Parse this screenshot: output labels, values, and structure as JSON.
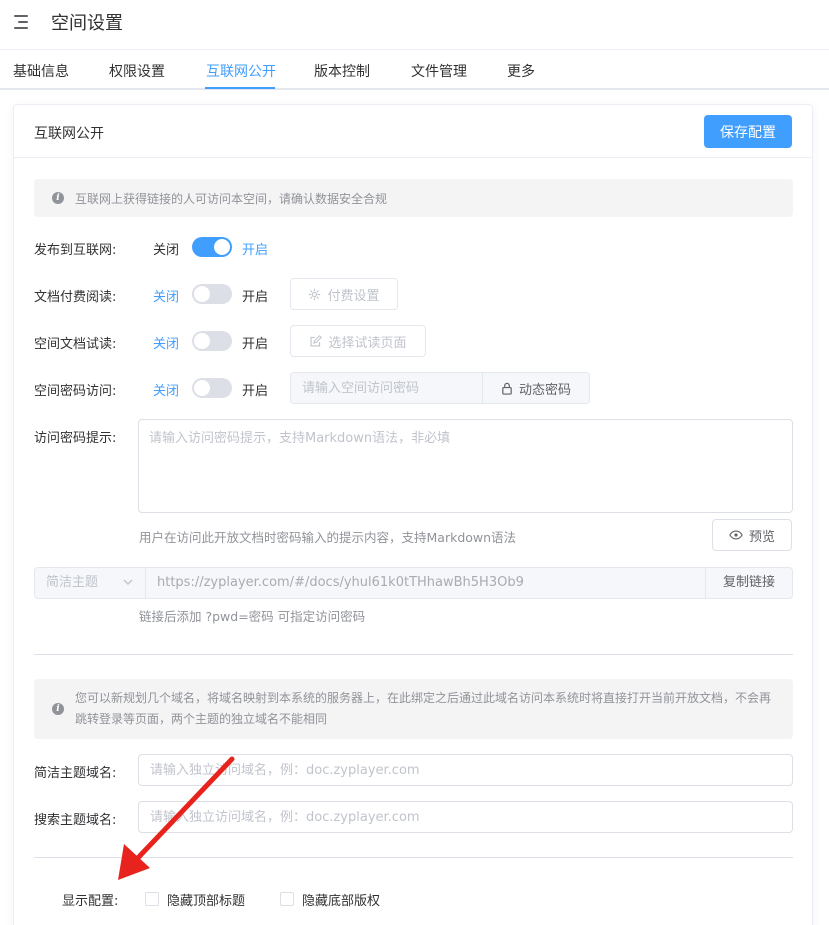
{
  "header": {
    "title": "空间设置"
  },
  "tabs": [
    {
      "label": "基础信息"
    },
    {
      "label": "权限设置"
    },
    {
      "label": "互联网公开",
      "active": true
    },
    {
      "label": "版本控制"
    },
    {
      "label": "文件管理"
    },
    {
      "label": "更多"
    }
  ],
  "card": {
    "title": "互联网公开",
    "save_button": "保存配置",
    "alert_public": "互联网上获得链接的人可访问本空间，请确认数据安全合规",
    "publish": {
      "label": "发布到互联网:",
      "off": "关闭",
      "on": "开启",
      "enabled": true
    },
    "paid_reading": {
      "label": "文档付费阅读:",
      "off": "关闭",
      "on": "开启",
      "enabled": false,
      "button": "付费设置"
    },
    "trial_reading": {
      "label": "空间文档试读:",
      "off": "关闭",
      "on": "开启",
      "enabled": false,
      "button": "选择试读页面"
    },
    "password_access": {
      "label": "空间密码访问:",
      "off": "关闭",
      "on": "开启",
      "enabled": false,
      "placeholder": "请输入空间访问密码",
      "button": "动态密码"
    },
    "password_hint": {
      "label": "访问密码提示:",
      "placeholder": "请输入访问密码提示，支持Markdown语法，非必填",
      "help": "用户在访问此开放文档时密码输入的提示内容，支持Markdown语法",
      "preview_button": "预览"
    },
    "share": {
      "theme_select": "简洁主题",
      "url": "https://zyplayer.com/#/docs/yhul61k0tTHhawBh5H3Ob9",
      "copy_button": "复制链接",
      "help": "链接后添加 ?pwd=密码 可指定访问密码"
    },
    "alert_domain": "您可以新规划几个域名，将域名映射到本系统的服务器上，在此绑定之后通过此域名访问本系统时将直接打开当前开放文档，不会再跳转登录等页面，两个主题的独立域名不能相同",
    "simple_domain": {
      "label": "简洁主题域名:",
      "placeholder": "请输入独立访问域名，例：doc.zyplayer.com"
    },
    "search_domain": {
      "label": "搜索主题域名:",
      "placeholder": "请输入独立访问域名，例：doc.zyplayer.com"
    },
    "display": {
      "label": "显示配置:",
      "hide_top": "隐藏顶部标题",
      "hide_bottom": "隐藏底部版权"
    }
  },
  "icons": {
    "menu": "menu-fold-icon",
    "info": "info-icon",
    "gear": "gear-icon",
    "edit": "edit-icon",
    "lock": "lock-icon",
    "eye": "eye-icon",
    "caret": "chevron-down-icon",
    "annotation": "red-arrow-annotation"
  },
  "colors": {
    "primary": "#409eff",
    "arrow": "#e8231e"
  }
}
